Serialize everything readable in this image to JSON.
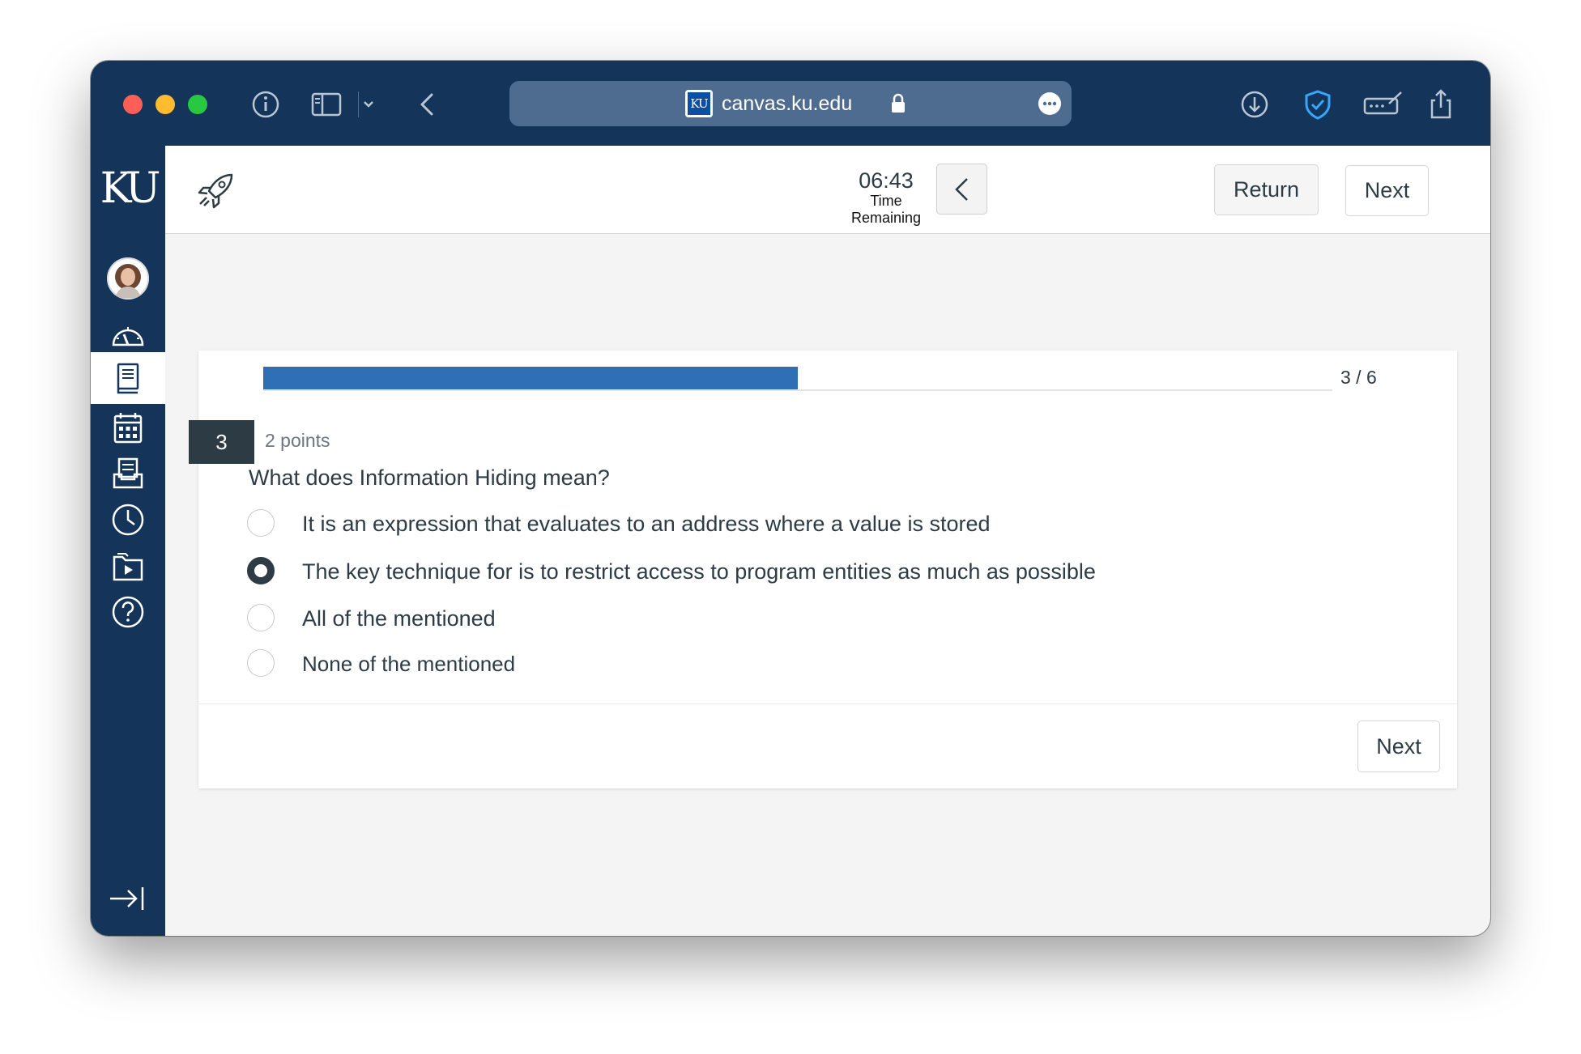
{
  "browser": {
    "url": "canvas.ku.edu",
    "favicon_text": "KU"
  },
  "sidebar": {
    "logo": "KU",
    "items": [
      {
        "name": "account"
      },
      {
        "name": "dashboard"
      },
      {
        "name": "courses",
        "active": true
      },
      {
        "name": "calendar"
      },
      {
        "name": "inbox"
      },
      {
        "name": "history"
      },
      {
        "name": "studio"
      },
      {
        "name": "help"
      }
    ]
  },
  "header": {
    "timer_value": "06:43",
    "timer_label": "Time Remaining",
    "return_label": "Return",
    "next_label": "Next"
  },
  "quiz": {
    "progress_text": "3 / 6",
    "progress_fraction": 0.5,
    "question_number": "3",
    "points": "2 points",
    "question": "What does Information Hiding mean?",
    "answers": [
      {
        "text": " It is an expression that evaluates to an address where a value is stored",
        "selected": false
      },
      {
        "text": "The key technique for is to restrict access to program entities as much as possible",
        "selected": true
      },
      {
        "text": "All of the mentioned",
        "selected": false
      },
      {
        "text": "None of the mentioned",
        "selected": false
      }
    ],
    "footer_next_label": "Next"
  },
  "colors": {
    "navy": "#15345a",
    "progress": "#2f6fb5",
    "text": "#2d3b45"
  }
}
